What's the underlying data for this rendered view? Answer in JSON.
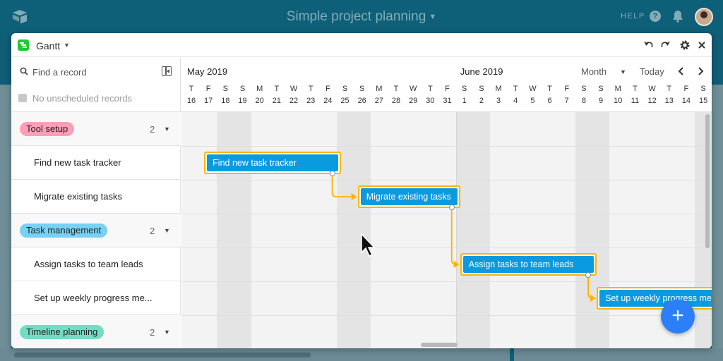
{
  "app": {
    "base_title": "Simple project planning",
    "help_label": "HELP",
    "help_icon_glyph": "?",
    "logo_icon": "airtable-logo-icon",
    "bell_icon": "bell-icon",
    "avatar_icon": "avatar"
  },
  "view": {
    "name": "Gantt",
    "icon": "gantt-icon",
    "icon_color": "#20c933",
    "header_icons": [
      "undo-icon",
      "redo-icon",
      "gear-icon",
      "close-icon"
    ]
  },
  "left_panel": {
    "find_placeholder": "Find a record",
    "unscheduled_text": "No unscheduled records",
    "rows": [
      {
        "type": "group",
        "label": "Tool setup",
        "count": "2",
        "color": "#ff9eb7"
      },
      {
        "type": "record",
        "label": "Find new task tracker"
      },
      {
        "type": "record",
        "label": "Migrate existing tasks"
      },
      {
        "type": "group",
        "label": "Task management",
        "count": "2",
        "color": "#77d1f3"
      },
      {
        "type": "record",
        "label": "Assign tasks to team leads"
      },
      {
        "type": "record",
        "label": "Set up weekly progress me..."
      },
      {
        "type": "group",
        "label": "Timeline planning",
        "count": "2",
        "color": "#72ddc3"
      }
    ]
  },
  "timeline": {
    "months": [
      {
        "label": "May 2019",
        "start_day_index": 0
      },
      {
        "label": "June 2019",
        "start_day_index": 16
      }
    ],
    "scale_label": "Month",
    "today_label": "Today",
    "prev_icon": "chevron-left-icon",
    "next_icon": "chevron-right-icon",
    "days": [
      {
        "letter": "T",
        "num": "16"
      },
      {
        "letter": "F",
        "num": "17"
      },
      {
        "letter": "S",
        "num": "18"
      },
      {
        "letter": "S",
        "num": "19"
      },
      {
        "letter": "M",
        "num": "20"
      },
      {
        "letter": "T",
        "num": "21"
      },
      {
        "letter": "W",
        "num": "22"
      },
      {
        "letter": "T",
        "num": "23"
      },
      {
        "letter": "F",
        "num": "24"
      },
      {
        "letter": "S",
        "num": "25"
      },
      {
        "letter": "S",
        "num": "26"
      },
      {
        "letter": "M",
        "num": "27"
      },
      {
        "letter": "T",
        "num": "28"
      },
      {
        "letter": "W",
        "num": "29"
      },
      {
        "letter": "T",
        "num": "30"
      },
      {
        "letter": "F",
        "num": "31"
      },
      {
        "letter": "S",
        "num": "1"
      },
      {
        "letter": "S",
        "num": "2"
      },
      {
        "letter": "M",
        "num": "3"
      },
      {
        "letter": "T",
        "num": "4"
      },
      {
        "letter": "W",
        "num": "5"
      },
      {
        "letter": "T",
        "num": "6"
      },
      {
        "letter": "F",
        "num": "7"
      },
      {
        "letter": "S",
        "num": "8"
      },
      {
        "letter": "S",
        "num": "9"
      },
      {
        "letter": "M",
        "num": "10"
      },
      {
        "letter": "T",
        "num": "11"
      },
      {
        "letter": "W",
        "num": "12"
      },
      {
        "letter": "T",
        "num": "13"
      },
      {
        "letter": "F",
        "num": "14"
      },
      {
        "letter": "S",
        "num": "15"
      }
    ],
    "bars": [
      {
        "label": "Find new task tracker",
        "row": 1,
        "start": 1,
        "end": 9
      },
      {
        "label": "Migrate existing tasks",
        "row": 2,
        "start": 10,
        "end": 16
      },
      {
        "label": "Assign tasks to team leads",
        "row": 4,
        "start": 16,
        "end": 24
      },
      {
        "label": "Set up weekly progress meeting",
        "row": 5,
        "start": 24,
        "end": 33
      }
    ],
    "dependency_color": "#fcb400",
    "bar_color": "#0a9ae0"
  },
  "add_button_label": "+",
  "add_button_color": "#2d7ff9"
}
